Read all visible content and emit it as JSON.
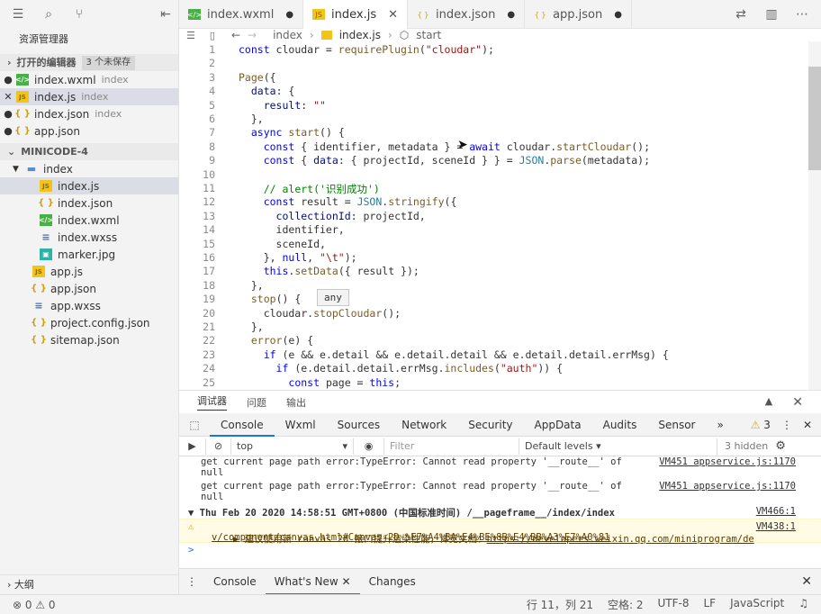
{
  "sidebar": {
    "title": "资源管理器",
    "open_editors_label": "打开的编辑器",
    "unsaved_badge": "3 个未保存",
    "open_editors": [
      {
        "marker": "●",
        "name": "index.wxml",
        "hint": "index",
        "type": "wxml"
      },
      {
        "marker": "✕",
        "name": "index.js",
        "hint": "index",
        "type": "js",
        "selected": true
      },
      {
        "marker": "●",
        "name": "index.json",
        "hint": "index",
        "type": "json"
      },
      {
        "marker": "●",
        "name": "app.json",
        "hint": "",
        "type": "json"
      }
    ],
    "project_label": "MINICODE-4",
    "folder": "index",
    "folder_files": [
      {
        "name": "index.js",
        "type": "js",
        "selected": true
      },
      {
        "name": "index.json",
        "type": "json"
      },
      {
        "name": "index.wxml",
        "type": "wxml"
      },
      {
        "name": "index.wxss",
        "type": "wxss"
      },
      {
        "name": "marker.jpg",
        "type": "img"
      }
    ],
    "root_files": [
      {
        "name": "app.js",
        "type": "js"
      },
      {
        "name": "app.json",
        "type": "json"
      },
      {
        "name": "app.wxss",
        "type": "wxss"
      },
      {
        "name": "project.config.json",
        "type": "json"
      },
      {
        "name": "sitemap.json",
        "type": "json"
      }
    ],
    "outline_label": "大纲"
  },
  "tabs": [
    {
      "label": "index.wxml",
      "type": "wxml",
      "state": "●"
    },
    {
      "label": "index.js",
      "type": "js",
      "state": "✕",
      "active": true
    },
    {
      "label": "index.json",
      "type": "json",
      "state": "●"
    },
    {
      "label": "app.json",
      "type": "json",
      "state": "●"
    }
  ],
  "breadcrumb": {
    "folder": "index",
    "file": "index.js",
    "symbol": "start"
  },
  "editor": {
    "tooltip": "any",
    "lines": [
      {
        "n": "1",
        "html": "<span class=\"kw\">const</span> cloudar = <span class=\"fn\">requirePlugin</span>(<span class=\"str\">\"cloudar\"</span>);"
      },
      {
        "n": "2",
        "html": ""
      },
      {
        "n": "3",
        "html": "<span class=\"fn\">Page</span>({"
      },
      {
        "n": "4",
        "html": "  <span class=\"prop\">data</span>: {"
      },
      {
        "n": "5",
        "html": "    <span class=\"prop\">result</span>: <span class=\"str\">\"\"</span>"
      },
      {
        "n": "6",
        "html": "  },"
      },
      {
        "n": "7",
        "html": "  <span class=\"kw\">async</span> <span class=\"fn\">start</span>() {"
      },
      {
        "n": "8",
        "html": "    <span class=\"kw\">const</span> { identifier, metadata } = <span class=\"kw\">await</span> cloudar.<span class=\"fn\">startCloudar</span>();"
      },
      {
        "n": "9",
        "html": "    <span class=\"kw\">const</span> { <span class=\"prop\">data</span>: { projectId, sceneId } } = <span class=\"cls\">JSON</span>.<span class=\"fn\">parse</span>(metadata);"
      },
      {
        "n": "10",
        "html": ""
      },
      {
        "n": "11",
        "html": "    <span class=\"cmt\">// alert('识别成功')</span>"
      },
      {
        "n": "12",
        "html": "    <span class=\"kw\">const</span> result = <span class=\"cls\">JSON</span>.<span class=\"fn\">stringify</span>({"
      },
      {
        "n": "13",
        "html": "      <span class=\"prop\">collectionId</span>: projectId,"
      },
      {
        "n": "14",
        "html": "      identifier,"
      },
      {
        "n": "15",
        "html": "      sceneId,"
      },
      {
        "n": "16",
        "html": "    }, <span class=\"kw\">null</span>, <span class=\"str\">\"\\t\"</span>);"
      },
      {
        "n": "17",
        "html": "    <span class=\"kw\">this</span>.<span class=\"fn\">setData</span>({ result });"
      },
      {
        "n": "18",
        "html": "  },"
      },
      {
        "n": "19",
        "html": "  <span class=\"fn\">stop</span>() {"
      },
      {
        "n": "20",
        "html": "    cloudar.<span class=\"fn\">stopCloudar</span>();"
      },
      {
        "n": "21",
        "html": "  },"
      },
      {
        "n": "22",
        "html": "  <span class=\"fn\">error</span>(e) {"
      },
      {
        "n": "23",
        "html": "    <span class=\"kw\">if</span> (e &amp;&amp; e.detail &amp;&amp; e.detail.detail &amp;&amp; e.detail.detail.errMsg) {"
      },
      {
        "n": "24",
        "html": "      <span class=\"kw\">if</span> (e.detail.detail.errMsg.<span class=\"fn\">includes</span>(<span class=\"str\">\"auth\"</span>)) {"
      },
      {
        "n": "25",
        "html": "        <span class=\"kw\">const</span> page = <span class=\"kw\">this</span>;"
      }
    ]
  },
  "panel": {
    "tabs": [
      "调试器",
      "问题",
      "输出"
    ],
    "devtools_tabs": [
      "Console",
      "Wxml",
      "Sources",
      "Network",
      "Security",
      "AppData",
      "Audits",
      "Sensor",
      "»"
    ],
    "warn_count": "3",
    "context": "top",
    "filter_placeholder": "Filter",
    "levels": "Default levels",
    "hidden": "3 hidden",
    "logs": [
      {
        "text": "get current page path error:TypeError: Cannot read property '__route__' of",
        "cont": "null",
        "src": "VM451 appservice.js:1170"
      },
      {
        "text": "get current page path error:TypeError: Cannot read property '__route__' of",
        "cont": "null",
        "src": "VM451 appservice.js:1170"
      }
    ],
    "group_line": "▼ Thu Feb 20 2020 14:58:51 GMT+0800 (中国标准时间) /__pageframe__/index/index",
    "group_src": "VM466:1",
    "warning_text": "▶ 建议使用新 canvas 2d 接口提升渲染性能，详见文档：",
    "warning_link1": "https://developers.weixin.qq.com/miniprogram/de",
    "warning_link2": "v/component/canvas.html#Canvas-2D-%E7%A4%BA%E4%BE%8B%E4%BB%A3%E7%A0%81",
    "warning_src": "VM438:1",
    "prompt": ">",
    "drawer_tabs": [
      "Console",
      "What's New",
      "Changes"
    ]
  },
  "status": {
    "problems": "⊗ 0  ⚠ 0",
    "position": "行 11，列 21",
    "spaces": "空格: 2",
    "encoding": "UTF-8",
    "eol": "LF",
    "language": "JavaScript",
    "bell": "🔔"
  },
  "colors": {
    "accent": "#1a73e8",
    "keyword": "#0000ff",
    "string": "#a31515"
  }
}
